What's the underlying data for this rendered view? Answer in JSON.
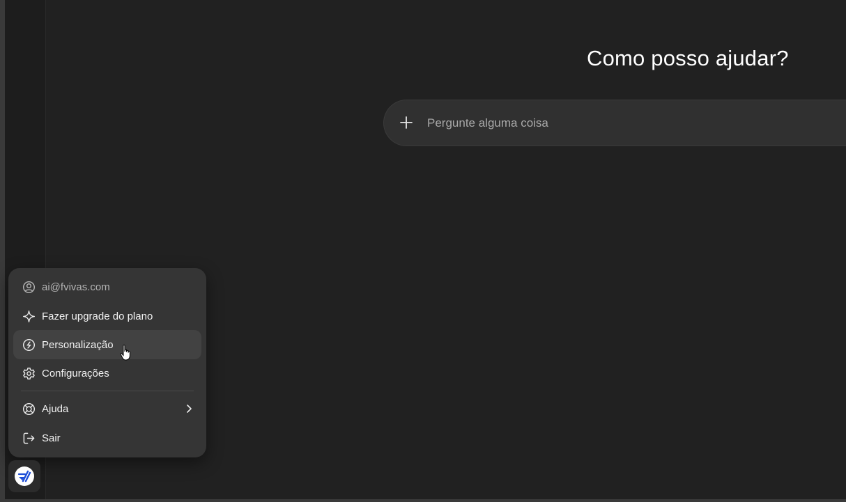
{
  "main": {
    "heading": "Como posso ajudar?",
    "composer": {
      "placeholder": "Pergunte alguma coisa",
      "value": ""
    }
  },
  "account_menu": {
    "email": "ai@fvivas.com",
    "items": [
      {
        "label": "Fazer upgrade do plano",
        "icon": "sparkle-icon"
      },
      {
        "label": "Personalização",
        "icon": "personalization-icon"
      },
      {
        "label": "Configurações",
        "icon": "gear-icon"
      },
      {
        "label": "Ajuda",
        "icon": "lifebuoy-icon",
        "has_submenu": true
      },
      {
        "label": "Sair",
        "icon": "logout-icon"
      }
    ],
    "hovered_item": "Personalização"
  },
  "colors": {
    "background": "#212121",
    "menu_background": "#353535",
    "menu_hover": "#424242",
    "composer_background": "#303030",
    "avatar_accent": "#1f4fd8"
  }
}
